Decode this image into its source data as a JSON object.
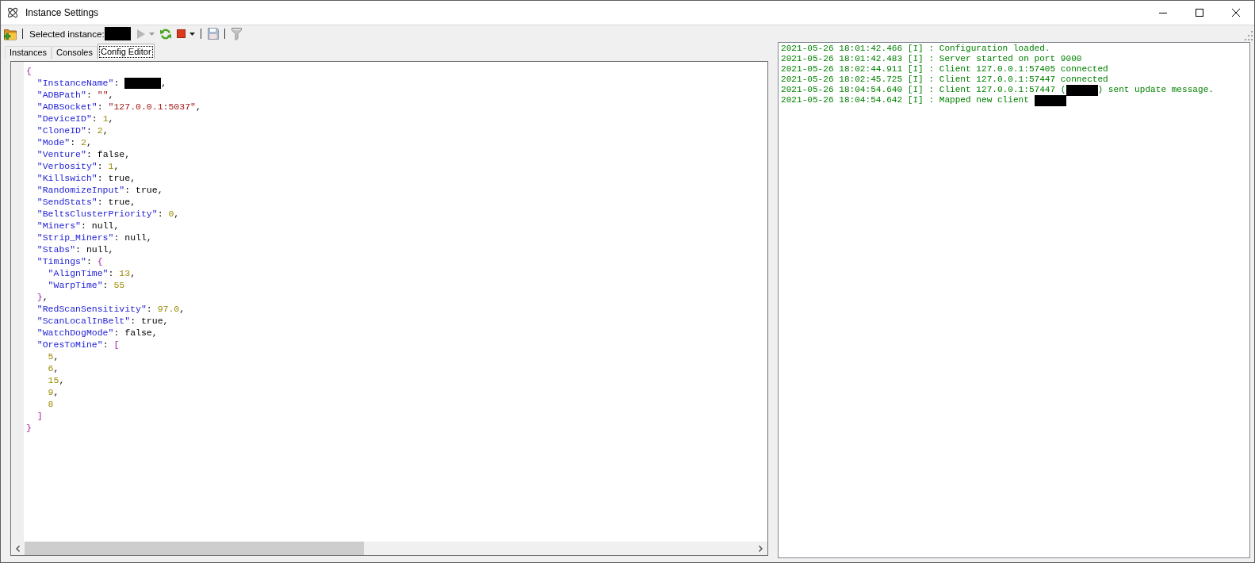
{
  "window": {
    "title": "Instance Settings"
  },
  "toolbar": {
    "items": [
      {
        "kind": "open",
        "disabled": false
      },
      {
        "kind": "separator"
      },
      {
        "kind": "label",
        "text": "Selected instance:"
      },
      {
        "kind": "redacted"
      },
      {
        "kind": "play",
        "disabled": true
      },
      {
        "kind": "dropdown",
        "disabled": true
      },
      {
        "kind": "refresh",
        "disabled": false
      },
      {
        "kind": "stop",
        "disabled": false
      },
      {
        "kind": "dropdown",
        "disabled": false
      },
      {
        "kind": "separator"
      },
      {
        "kind": "save",
        "disabled": true
      },
      {
        "kind": "separator"
      },
      {
        "kind": "filter",
        "disabled": true
      }
    ]
  },
  "tabs": [
    {
      "label": "Instances",
      "selected": false
    },
    {
      "label": "Consoles",
      "selected": false
    },
    {
      "label": "Config Editor",
      "selected": true
    }
  ],
  "editor": {
    "lines": [
      {
        "tokens": [
          {
            "kind": "bracket",
            "text": "{"
          }
        ],
        "children": [
          {
            "tokens": [
              {
                "kind": "key",
                "text": "\"InstanceName\""
              },
              {
                "kind": "punct",
                "text": ": "
              },
              {
                "kind": "redacted"
              },
              {
                "kind": "punct",
                "text": ","
              }
            ]
          },
          {
            "tokens": [
              {
                "kind": "key",
                "text": "\"ADBPath\""
              },
              {
                "kind": "punct",
                "text": ": "
              },
              {
                "kind": "string",
                "text": "\"\""
              },
              {
                "kind": "punct",
                "text": ","
              }
            ]
          },
          {
            "tokens": [
              {
                "kind": "key",
                "text": "\"ADBSocket\""
              },
              {
                "kind": "punct",
                "text": ": "
              },
              {
                "kind": "string",
                "text": "\"127.0.0.1:5037\""
              },
              {
                "kind": "punct",
                "text": ","
              }
            ]
          },
          {
            "tokens": [
              {
                "kind": "key",
                "text": "\"DeviceID\""
              },
              {
                "kind": "punct",
                "text": ": "
              },
              {
                "kind": "number",
                "text": "1"
              },
              {
                "kind": "punct",
                "text": ","
              }
            ]
          },
          {
            "tokens": [
              {
                "kind": "key",
                "text": "\"CloneID\""
              },
              {
                "kind": "punct",
                "text": ": "
              },
              {
                "kind": "number",
                "text": "2"
              },
              {
                "kind": "punct",
                "text": ","
              }
            ]
          },
          {
            "tokens": [
              {
                "kind": "key",
                "text": "\"Mode\""
              },
              {
                "kind": "punct",
                "text": ": "
              },
              {
                "kind": "number",
                "text": "2"
              },
              {
                "kind": "punct",
                "text": ","
              }
            ]
          },
          {
            "tokens": [
              {
                "kind": "key",
                "text": "\"Venture\""
              },
              {
                "kind": "punct",
                "text": ": "
              },
              {
                "kind": "literal",
                "text": "false"
              },
              {
                "kind": "punct",
                "text": ","
              }
            ]
          },
          {
            "tokens": [
              {
                "kind": "key",
                "text": "\"Verbosity\""
              },
              {
                "kind": "punct",
                "text": ": "
              },
              {
                "kind": "number",
                "text": "1"
              },
              {
                "kind": "punct",
                "text": ","
              }
            ]
          },
          {
            "tokens": [
              {
                "kind": "key",
                "text": "\"Killswich\""
              },
              {
                "kind": "punct",
                "text": ": "
              },
              {
                "kind": "literal",
                "text": "true"
              },
              {
                "kind": "punct",
                "text": ","
              }
            ]
          },
          {
            "tokens": [
              {
                "kind": "key",
                "text": "\"RandomizeInput\""
              },
              {
                "kind": "punct",
                "text": ": "
              },
              {
                "kind": "literal",
                "text": "true"
              },
              {
                "kind": "punct",
                "text": ","
              }
            ]
          },
          {
            "tokens": [
              {
                "kind": "key",
                "text": "\"SendStats\""
              },
              {
                "kind": "punct",
                "text": ": "
              },
              {
                "kind": "literal",
                "text": "true"
              },
              {
                "kind": "punct",
                "text": ","
              }
            ]
          },
          {
            "tokens": [
              {
                "kind": "key",
                "text": "\"BeltsClusterPriority\""
              },
              {
                "kind": "punct",
                "text": ": "
              },
              {
                "kind": "number",
                "text": "0"
              },
              {
                "kind": "punct",
                "text": ","
              }
            ]
          },
          {
            "tokens": [
              {
                "kind": "key",
                "text": "\"Miners\""
              },
              {
                "kind": "punct",
                "text": ": "
              },
              {
                "kind": "literal",
                "text": "null"
              },
              {
                "kind": "punct",
                "text": ","
              }
            ]
          },
          {
            "tokens": [
              {
                "kind": "key",
                "text": "\"Strip_Miners\""
              },
              {
                "kind": "punct",
                "text": ": "
              },
              {
                "kind": "literal",
                "text": "null"
              },
              {
                "kind": "punct",
                "text": ","
              }
            ]
          },
          {
            "tokens": [
              {
                "kind": "key",
                "text": "\"Stabs\""
              },
              {
                "kind": "punct",
                "text": ": "
              },
              {
                "kind": "literal",
                "text": "null"
              },
              {
                "kind": "punct",
                "text": ","
              }
            ]
          },
          {
            "tokens": [
              {
                "kind": "key",
                "text": "\"Timings\""
              },
              {
                "kind": "punct",
                "text": ": "
              },
              {
                "kind": "bracket",
                "text": "{"
              }
            ],
            "children": [
              {
                "tokens": [
                  {
                    "kind": "key",
                    "text": "\"AlignTime\""
                  },
                  {
                    "kind": "punct",
                    "text": ": "
                  },
                  {
                    "kind": "number",
                    "text": "13"
                  },
                  {
                    "kind": "punct",
                    "text": ","
                  }
                ]
              },
              {
                "tokens": [
                  {
                    "kind": "key",
                    "text": "\"WarpTime\""
                  },
                  {
                    "kind": "punct",
                    "text": ": "
                  },
                  {
                    "kind": "number",
                    "text": "55"
                  }
                ]
              }
            ]
          },
          {
            "tokens": [
              {
                "kind": "bracket",
                "text": "}"
              },
              {
                "kind": "punct",
                "text": ","
              }
            ]
          },
          {
            "tokens": [
              {
                "kind": "key",
                "text": "\"RedScanSensitivity\""
              },
              {
                "kind": "punct",
                "text": ": "
              },
              {
                "kind": "number",
                "text": "97.0"
              },
              {
                "kind": "punct",
                "text": ","
              }
            ]
          },
          {
            "tokens": [
              {
                "kind": "key",
                "text": "\"ScanLocalInBelt\""
              },
              {
                "kind": "punct",
                "text": ": "
              },
              {
                "kind": "literal",
                "text": "true"
              },
              {
                "kind": "punct",
                "text": ","
              }
            ]
          },
          {
            "tokens": [
              {
                "kind": "key",
                "text": "\"WatchDogMode\""
              },
              {
                "kind": "punct",
                "text": ": "
              },
              {
                "kind": "literal",
                "text": "false"
              },
              {
                "kind": "punct",
                "text": ","
              }
            ]
          },
          {
            "tokens": [
              {
                "kind": "key",
                "text": "\"OresToMine\""
              },
              {
                "kind": "punct",
                "text": ": "
              },
              {
                "kind": "bracket",
                "text": "["
              }
            ],
            "children": [
              {
                "tokens": [
                  {
                    "kind": "number",
                    "text": "5"
                  },
                  {
                    "kind": "punct",
                    "text": ","
                  }
                ]
              },
              {
                "tokens": [
                  {
                    "kind": "number",
                    "text": "6"
                  },
                  {
                    "kind": "punct",
                    "text": ","
                  }
                ]
              },
              {
                "tokens": [
                  {
                    "kind": "number",
                    "text": "15"
                  },
                  {
                    "kind": "punct",
                    "text": ","
                  }
                ]
              },
              {
                "tokens": [
                  {
                    "kind": "number",
                    "text": "9"
                  },
                  {
                    "kind": "punct",
                    "text": ","
                  }
                ]
              },
              {
                "tokens": [
                  {
                    "kind": "number",
                    "text": "8"
                  }
                ]
              }
            ]
          },
          {
            "tokens": [
              {
                "kind": "bracket",
                "text": "]"
              }
            ]
          }
        ]
      },
      {
        "tokens": [
          {
            "kind": "bracket",
            "text": "}"
          }
        ]
      }
    ]
  },
  "log": {
    "lines": [
      {
        "tokens": [
          {
            "kind": "text",
            "text": "2021-05-26 18:01:42.466 [I] : Configuration loaded."
          }
        ]
      },
      {
        "tokens": [
          {
            "kind": "text",
            "text": "2021-05-26 18:01:42.483 [I] : Server started on port 9000"
          }
        ]
      },
      {
        "tokens": [
          {
            "kind": "text",
            "text": "2021-05-26 18:02:44.911 [I] : Client 127.0.0.1:57405 connected"
          }
        ]
      },
      {
        "tokens": [
          {
            "kind": "text",
            "text": "2021-05-26 18:02:45.725 [I] : Client 127.0.0.1:57447 connected"
          }
        ]
      },
      {
        "tokens": [
          {
            "kind": "text",
            "text": "2021-05-26 18:04:54.640 [I] : Client 127.0.0.1:57447 ("
          },
          {
            "kind": "redacted"
          },
          {
            "kind": "text",
            "text": ") sent update message."
          }
        ]
      },
      {
        "tokens": [
          {
            "kind": "text",
            "text": "2021-05-26 18:04:54.642 [I] : Mapped new client "
          },
          {
            "kind": "redacted"
          }
        ]
      }
    ]
  }
}
